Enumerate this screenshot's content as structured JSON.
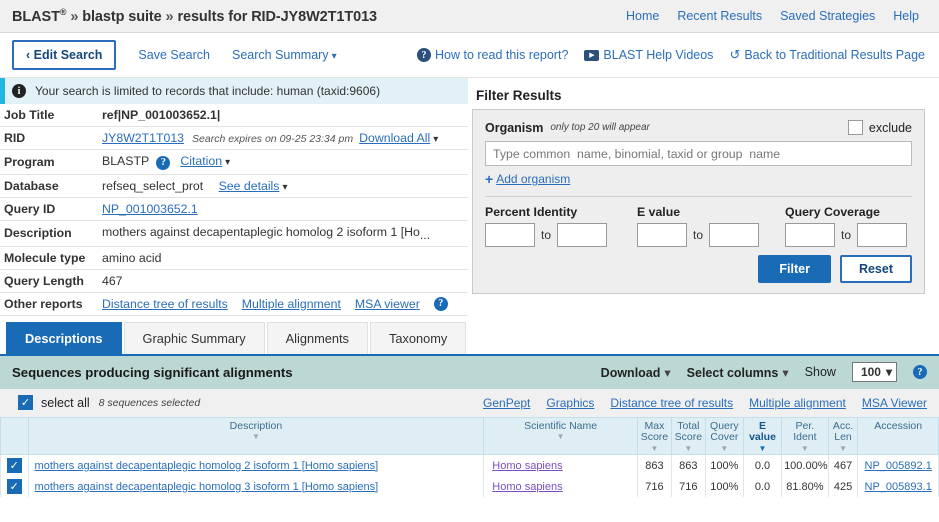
{
  "brand": {
    "name": "BLAST",
    "reg": "®",
    "sep1": "»",
    "suite": "blastp suite",
    "sep2": "»",
    "results_for": "results for RID-JY8W2T1T013",
    "nav": [
      {
        "label": "Home"
      },
      {
        "label": "Recent Results"
      },
      {
        "label": "Saved Strategies"
      },
      {
        "label": "Help"
      }
    ]
  },
  "actionbar": {
    "edit_search": "‹ Edit Search",
    "save_search": "Save Search",
    "search_summary": "Search Summary",
    "how_to_read": "How to read this report?",
    "help_videos": "BLAST Help Videos",
    "back_traditional": "Back to Traditional Results Page"
  },
  "info_banner": {
    "text": "Your search is limited to records that include: human (taxid:9606)"
  },
  "summary": {
    "rows": [
      {
        "label": "Job Title",
        "value": "ref|NP_001003652.1|"
      },
      {
        "label": "RID",
        "value": "JY8W2T1T013"
      },
      {
        "label": "Program",
        "value": "BLASTP"
      },
      {
        "label": "Database",
        "value": "refseq_select_prot"
      },
      {
        "label": "Query ID",
        "value": "NP_001003652.1"
      },
      {
        "label": "Description",
        "value": "mothers against decapentaplegic homolog 2 isoform 1 [Ho"
      },
      {
        "label": "Molecule type",
        "value": "amino acid"
      },
      {
        "label": "Query Length",
        "value": "467"
      },
      {
        "label": "Other reports",
        "value": ""
      }
    ],
    "rid_expires": "Search expires on 09-25 23:34 pm",
    "download_all": "Download All",
    "citation": "Citation",
    "see_details": "See details",
    "description_ellipsis": "...",
    "other_reports": [
      {
        "label": "Distance tree of results"
      },
      {
        "label": "Multiple alignment"
      },
      {
        "label": "MSA viewer"
      }
    ]
  },
  "filter": {
    "heading": "Filter Results",
    "organism_label": "Organism",
    "organism_note": "only top 20 will appear",
    "exclude_label": "exclude",
    "organism_placeholder": "Type common  name, binomial, taxid or group  name",
    "organism_value": "",
    "add_organism": "Add organism",
    "percent_identity_label": "Percent Identity",
    "percent_identity_from": "",
    "percent_identity_to": "",
    "evalue_label": "E value",
    "evalue_from": "",
    "evalue_to": "",
    "query_coverage_label": "Query Coverage",
    "query_coverage_from": "",
    "query_coverage_to": "",
    "to_label": "to",
    "filter_button": "Filter",
    "reset_button": "Reset"
  },
  "tabs": [
    {
      "label": "Descriptions",
      "active": true
    },
    {
      "label": "Graphic Summary",
      "active": false
    },
    {
      "label": "Alignments",
      "active": false
    },
    {
      "label": "Taxonomy",
      "active": false
    }
  ],
  "results_header": {
    "title": "Sequences producing significant alignments",
    "download": "Download",
    "select_columns": "Select columns",
    "show_label": "Show",
    "show_value": "100"
  },
  "select_all": {
    "label": "select all",
    "count_text": "8 sequences selected",
    "links": [
      {
        "label": "GenPept"
      },
      {
        "label": "Graphics"
      },
      {
        "label": "Distance tree of results"
      },
      {
        "label": "Multiple alignment"
      },
      {
        "label": "MSA Viewer"
      }
    ]
  },
  "table": {
    "columns": [
      {
        "line1": "Description",
        "line2": ""
      },
      {
        "line1": "Scientific Name",
        "line2": ""
      },
      {
        "line1": "Max",
        "line2": "Score"
      },
      {
        "line1": "Total",
        "line2": "Score"
      },
      {
        "line1": "Query",
        "line2": "Cover"
      },
      {
        "line1": "E",
        "line2": "value"
      },
      {
        "line1": "Per.",
        "line2": "Ident"
      },
      {
        "line1": "Acc.",
        "line2": "Len"
      },
      {
        "line1": "Accession",
        "line2": ""
      }
    ],
    "rows": [
      {
        "checked": true,
        "description": "mothers against decapentaplegic homolog 2 isoform 1 [Homo sapiens]",
        "scientific_name": "Homo sapiens",
        "max_score": "863",
        "total_score": "863",
        "query_cover": "100%",
        "e_value": "0.0",
        "per_ident": "100.00%",
        "acc_len": "467",
        "accession": "NP_005892.1"
      },
      {
        "checked": true,
        "description": "mothers against decapentaplegic homolog 3 isoform 1 [Homo sapiens]",
        "scientific_name": "Homo sapiens",
        "max_score": "716",
        "total_score": "716",
        "query_cover": "100%",
        "e_value": "0.0",
        "per_ident": "81.80%",
        "acc_len": "425",
        "accession": "NP_005893.1"
      }
    ]
  },
  "colors": {
    "accent_blue": "#1a6bb5",
    "link_blue": "#2a6ebb",
    "banner_blue": "#e1f1f7",
    "banner_rule": "#1fb6e0",
    "results_header_bg": "#bcd8d4",
    "table_header_bg": "#dfeef5",
    "panel_bg": "#eeeeee"
  }
}
